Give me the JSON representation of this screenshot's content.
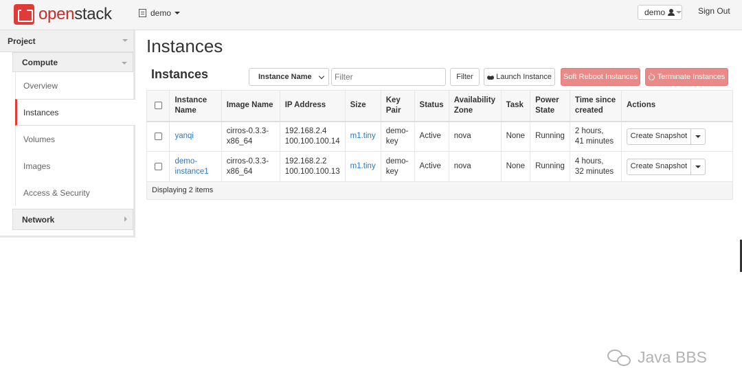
{
  "brand": {
    "prefix": "open",
    "suffix": "stack"
  },
  "topbar": {
    "project": "demo",
    "user": "demo",
    "sign_out": "Sign Out"
  },
  "sidebar": {
    "project": "Project",
    "compute": "Compute",
    "items": [
      {
        "label": "Overview"
      },
      {
        "label": "Instances"
      },
      {
        "label": "Volumes"
      },
      {
        "label": "Images"
      },
      {
        "label": "Access & Security"
      }
    ],
    "network": "Network"
  },
  "main": {
    "page_title": "Instances",
    "section_title": "Instances",
    "filter_field": "Instance Name",
    "filter_placeholder": "Filter",
    "filter_button": "Filter",
    "launch_button": "Launch Instance",
    "soft_reboot_button": "Soft Reboot Instances",
    "terminate_button": "Terminate Instances"
  },
  "table": {
    "headers": [
      "Instance Name",
      "Image Name",
      "IP Address",
      "Size",
      "Key Pair",
      "Status",
      "Availability Zone",
      "Task",
      "Power State",
      "Time since created",
      "Actions"
    ],
    "rows": [
      {
        "name": "yanqi",
        "image": "cirros-0.3.3-x86_64",
        "ip1": "192.168.2.4",
        "ip2": "100.100.100.14",
        "size": "m1.tiny",
        "key_pair": "demo-key",
        "status": "Active",
        "zone": "nova",
        "task": "None",
        "power": "Running",
        "time1": "2 hours,",
        "time2": "41 minutes",
        "action": "Create Snapshot"
      },
      {
        "name": "demo-instance1",
        "image": "cirros-0.3.3-x86_64",
        "ip1": "192.168.2.2",
        "ip2": "100.100.100.13",
        "size": "m1.tiny",
        "key_pair": "demo-key",
        "status": "Active",
        "zone": "nova",
        "task": "None",
        "power": "Running",
        "time1": "4 hours,",
        "time2": "32 minutes",
        "action": "Create Snapshot"
      }
    ],
    "footer": "Displaying 2 items"
  },
  "watermark": "Java BBS",
  "colors": {
    "accent": "#e03b38",
    "danger_button": "#ea8a88",
    "link": "#2a78c4"
  }
}
